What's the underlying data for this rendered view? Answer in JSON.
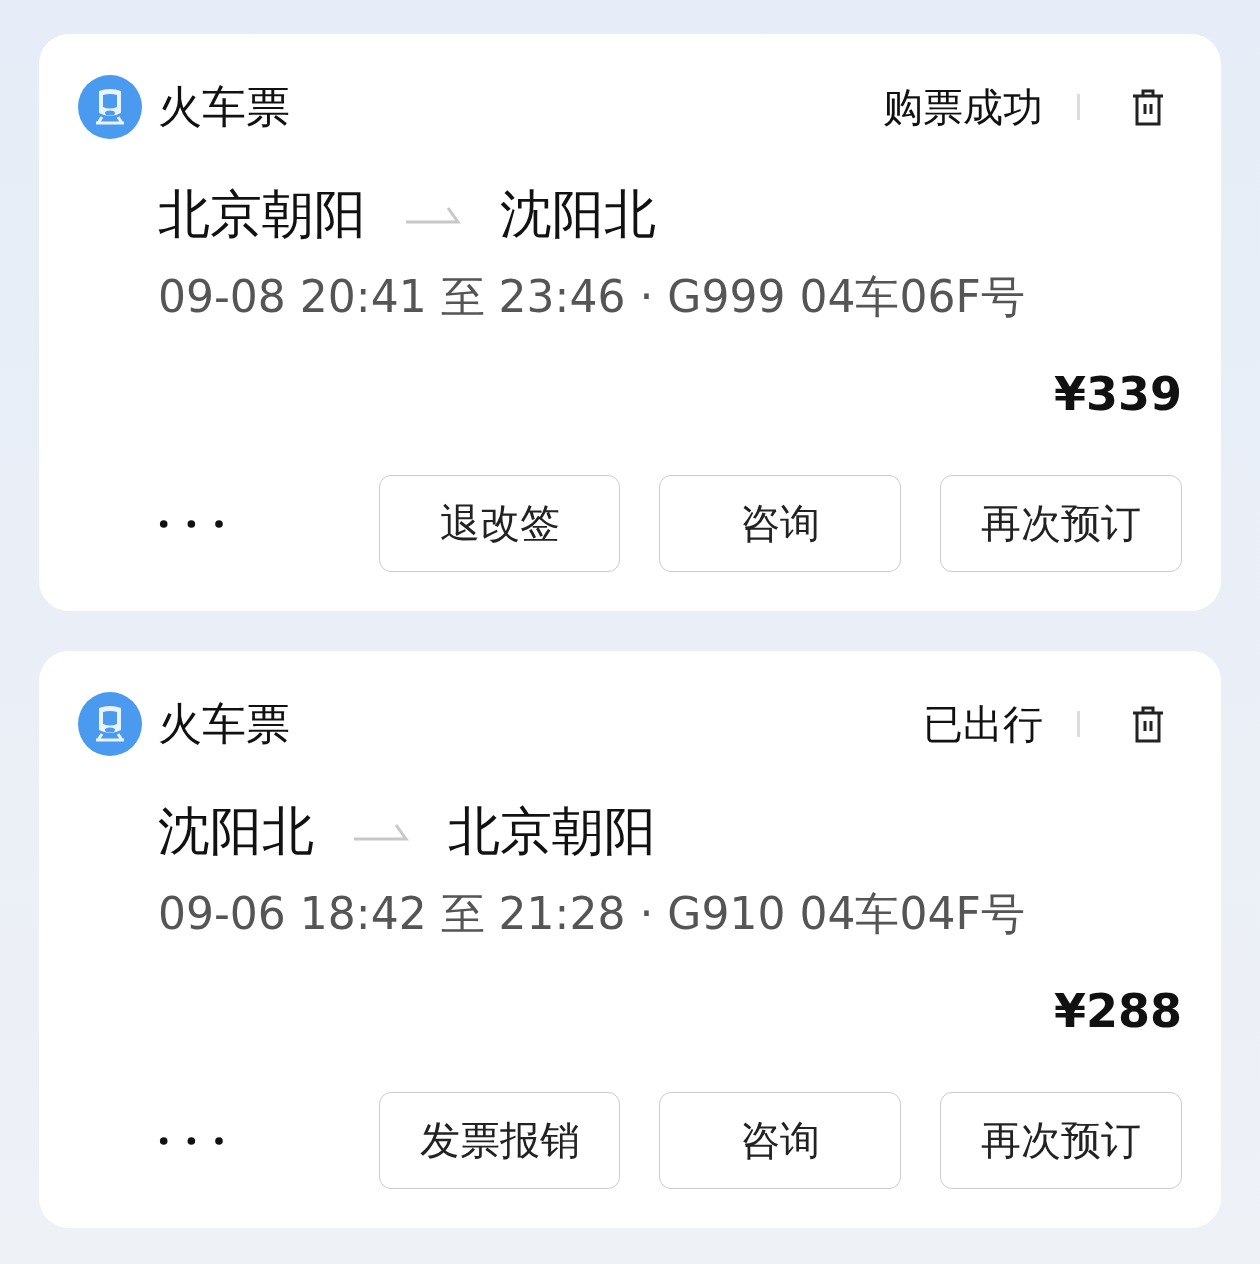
{
  "orders": [
    {
      "category": "火车票",
      "status": "购票成功",
      "from": "北京朝阳",
      "to": "沈阳北",
      "schedule": "09-08 20:41 至 23:46 · G999 04车06F号",
      "price": "¥339",
      "buttons": [
        "退改签",
        "咨询",
        "再次预订"
      ]
    },
    {
      "category": "火车票",
      "status": "已出行",
      "from": "沈阳北",
      "to": "北京朝阳",
      "schedule": "09-06 18:42 至 21:28 · G910 04车04F号",
      "price": "¥288",
      "buttons": [
        "发票报销",
        "咨询",
        "再次预订"
      ]
    }
  ]
}
